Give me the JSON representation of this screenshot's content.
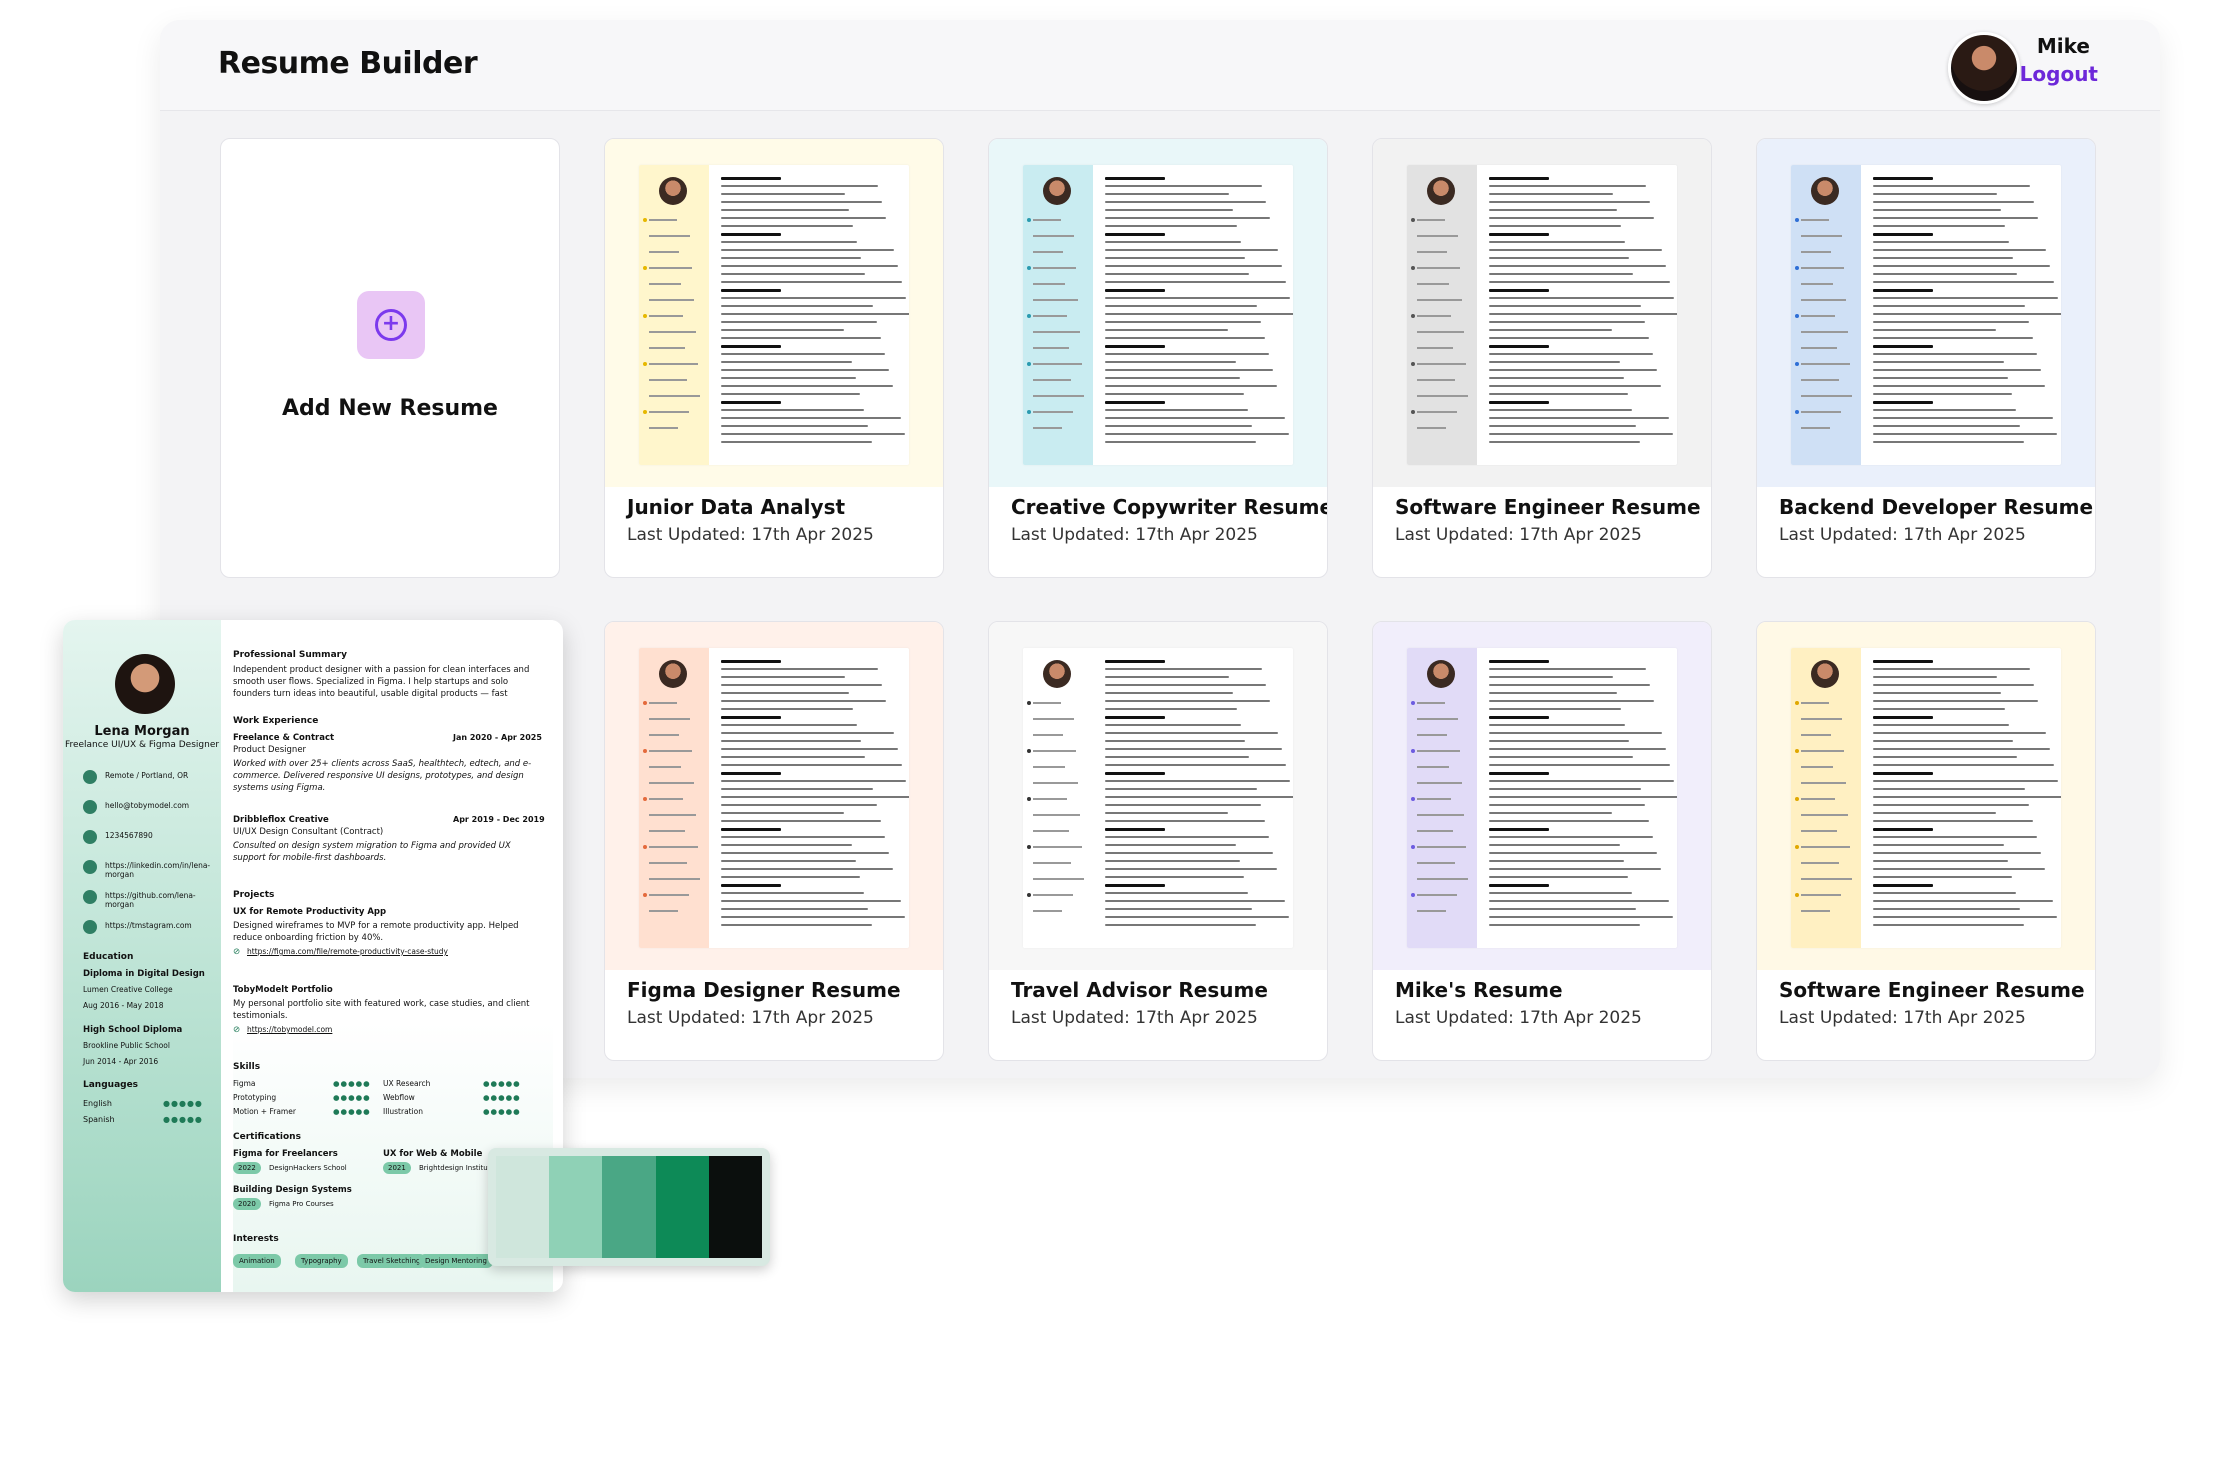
{
  "header": {
    "app_title": "Resume Builder",
    "user_name": "Mike",
    "logout_label": "Logout"
  },
  "add_card": {
    "label": "Add New Resume",
    "icon": "plus-circle-icon"
  },
  "resumes": [
    {
      "title": "Junior Data Analyst",
      "updated": "Last Updated: 17th Apr 2025",
      "bg": "#fffbe8",
      "side": "#fff6cc",
      "accent": "#e6b800"
    },
    {
      "title": "Creative Copywriter Resume",
      "updated": "Last Updated: 17th Apr 2025",
      "bg": "#e9f7f9",
      "side": "#c9ecf1",
      "accent": "#2a9bb0"
    },
    {
      "title": "Software Engineer Resume",
      "updated": "Last Updated: 17th Apr 2025",
      "bg": "#f2f2f2",
      "side": "#e2e2e2",
      "accent": "#555555"
    },
    {
      "title": "Backend Developer Resume",
      "updated": "Last Updated: 17th Apr 2025",
      "bg": "#eaf0fb",
      "side": "#cfe0f5",
      "accent": "#2f6fd6"
    },
    {
      "title": "Figma Designer Resume",
      "updated": "Last Updated: 17th Apr 2025",
      "bg": "#fff1ea",
      "side": "#ffe0d0",
      "accent": "#e46a3b"
    },
    {
      "title": "Travel Advisor Resume",
      "updated": "Last Updated: 17th Apr 2025",
      "bg": "#f7f7f7",
      "side": "#ffffff",
      "accent": "#333333"
    },
    {
      "title": "Mike's Resume",
      "updated": "Last Updated: 17th Apr 2025",
      "bg": "#f1eefb",
      "side": "#e1dbf7",
      "accent": "#6d5ce0"
    },
    {
      "title": "Software Engineer Resume",
      "updated": "Last Updated: 17th Apr 2025",
      "bg": "#fff9e6",
      "side": "#fff0c2",
      "accent": "#e0a800"
    }
  ],
  "preview": {
    "name": "Lena Morgan",
    "role": "Freelance UI/UX & Figma Designer",
    "contacts": [
      "Remote / Portland, OR",
      "hello@tobymodel.com",
      "1234567890",
      "https://linkedin.com/in/lena-morgan",
      "https://github.com/lena-morgan",
      "https://tmstagram.com"
    ],
    "education_heading": "Education",
    "education": [
      "Diploma in Digital Design",
      "Lumen Creative College",
      "Aug 2016 - May 2018",
      "High School Diploma",
      "Brookline Public School",
      "Jun 2014 - Apr 2016"
    ],
    "languages_heading": "Languages",
    "languages": [
      "English",
      "Spanish"
    ],
    "summary_heading": "Professional Summary",
    "summary": "Independent product designer with a passion for clean interfaces and smooth user flows. Specialized in Figma. I help startups and solo founders turn ideas into beautiful, usable digital products — fast",
    "work_heading": "Work Experience",
    "work": [
      {
        "company": "Freelance & Contract",
        "role": "Product Designer",
        "dates": "Jan 2020 - Apr 2025",
        "desc": "Worked with over 25+ clients across SaaS, healthtech, edtech, and e-commerce. Delivered responsive UI designs, prototypes, and design systems using Figma."
      },
      {
        "company": "Dribbleflox Creative",
        "role": "UI/UX Design Consultant (Contract)",
        "dates": "Apr 2019 - Dec 2019",
        "desc": "Consulted on design system migration to Figma and provided UX support for mobile-first dashboards."
      }
    ],
    "projects_heading": "Projects",
    "projects": [
      {
        "name": "UX for Remote Productivity App",
        "desc": "Designed wireframes to MVP for a remote productivity app. Helped reduce onboarding friction by 40%.",
        "link": "https://figma.com/file/remote-productivity-case-study"
      },
      {
        "name": "TobyModelt Portfolio",
        "desc": "My personal portfolio site with featured work, case studies, and client testimonials.",
        "link": "https://tobymodel.com"
      }
    ],
    "skills_heading": "Skills",
    "skills": [
      "Figma",
      "Prototyping",
      "Motion + Framer",
      "UX Research",
      "Webflow",
      "Illustration"
    ],
    "certs_heading": "Certifications",
    "certs": [
      "Figma for Freelancers",
      "UX for Web & Mobile",
      "Building Design Systems"
    ],
    "cert_years": [
      "2022",
      "2021",
      "2020"
    ],
    "cert_sources": [
      "DesignHackers School",
      "Brightdesign Institute",
      "Figma Pro Courses"
    ],
    "interests_heading": "Interests",
    "interests": [
      "Animation",
      "Typography",
      "Travel Sketching",
      "Design Mentoring"
    ]
  },
  "palette": {
    "colors": [
      "#cfe6dc",
      "#8fd1b6",
      "#4aa785",
      "#0d8a57",
      "#0b0f0d"
    ]
  }
}
